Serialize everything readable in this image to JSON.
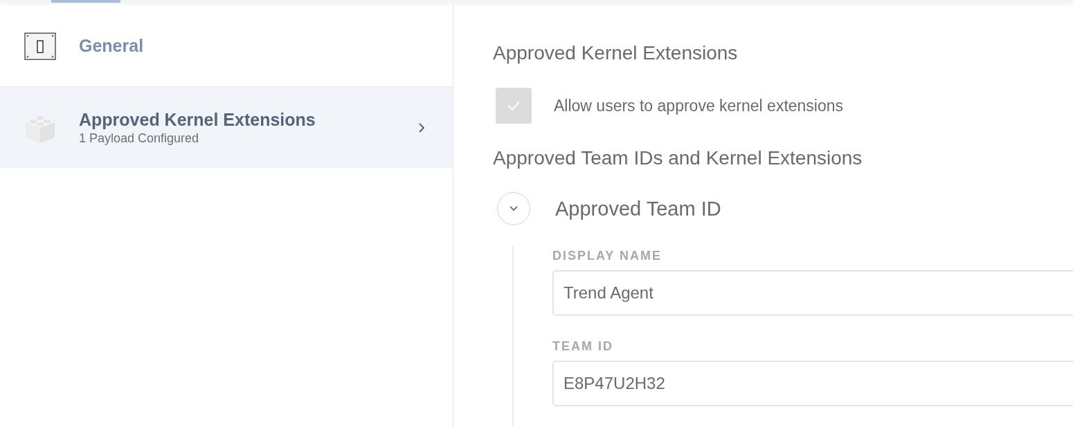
{
  "top_tabs": [
    {
      "selected": true
    }
  ],
  "sidebar": {
    "items": [
      {
        "kind": "switch",
        "title": "General",
        "selected": false,
        "has_chevron": false
      },
      {
        "kind": "brick",
        "title": "Approved Kernel Extensions",
        "subtitle": "1 Payload Configured",
        "selected": true,
        "has_chevron": true
      }
    ]
  },
  "main": {
    "title": "Approved Kernel Extensions",
    "allow_checkbox": {
      "label": "Allow users to approve kernel extensions",
      "checked": true,
      "disabled": true
    },
    "section_title": "Approved Team IDs and Kernel Extensions",
    "group": {
      "title": "Approved Team ID",
      "expanded": true,
      "fields": [
        {
          "label": "DISPLAY NAME",
          "value": "Trend Agent"
        },
        {
          "label": "TEAM ID",
          "value": "E8P47U2H32"
        }
      ]
    }
  }
}
